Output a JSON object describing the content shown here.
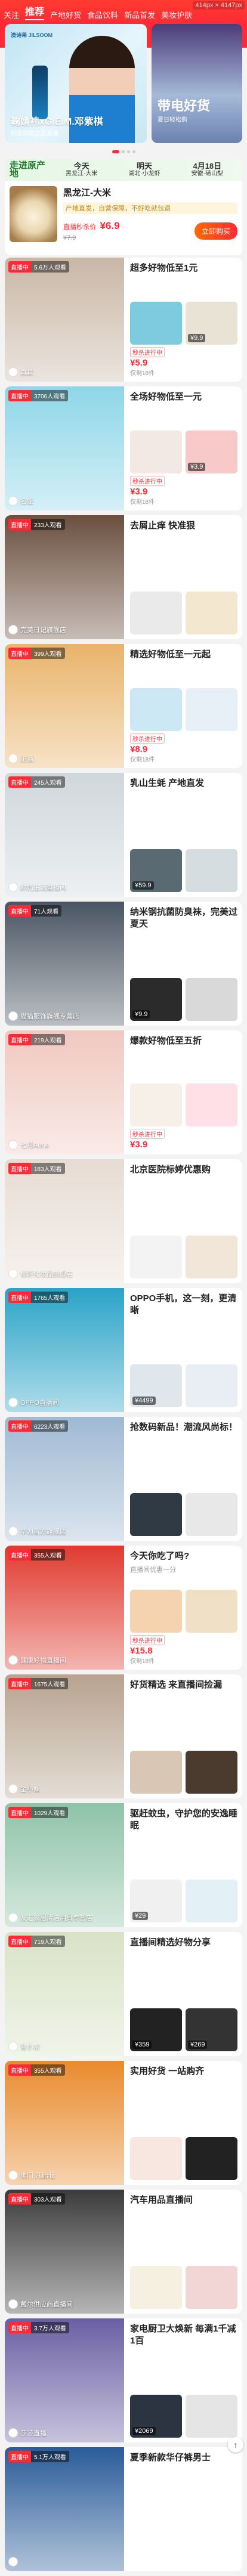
{
  "nav": {
    "tabs": [
      "关注",
      "推荐",
      "产地好货",
      "食品饮料",
      "新品首发",
      "美妆护肤"
    ],
    "active_index": 1,
    "dimension_label": "414px × 4147px"
  },
  "banner_main": {
    "brand": "澳诗茉 JILSOOM",
    "title": "鞠婧祎xG.E.M.邓紫棋",
    "subtitle": "明星同款正品直播"
  },
  "banner_side": {
    "word": "带电好货",
    "subtitle": "夏日轻松购"
  },
  "origin": {
    "logo": "走进原产地",
    "days": [
      {
        "label": "今天",
        "place": "黑龙江·大米"
      },
      {
        "label": "明天",
        "place": "湖北·小龙虾"
      },
      {
        "label": "4月18日",
        "place": "安徽·砀山梨"
      }
    ],
    "product_name": "黑龙江-大米",
    "tag": "产地直发，自营保障，不好吃就包退",
    "sale_label": "直播秒杀价",
    "price": "¥6.9",
    "orig_price": "¥7.9",
    "buy_label": "立即购买"
  },
  "cards": [
    {
      "views": "5.6万人观看",
      "host": "真真",
      "title": "超多好物低至1元",
      "tagline": "",
      "cover_color": "#c9b7a6",
      "products": [
        {
          "price": "¥5.9",
          "remain": "仅剩18件",
          "color": "#7ecbe0",
          "seckill": "秒杀进行中"
        },
        {
          "price": "¥9.9",
          "remain": "仅剩",
          "color": "#e9e3d6",
          "seckill": ""
        }
      ]
    },
    {
      "views": "3706人观看",
      "host": "名媛",
      "title": "全场好物低至一元",
      "tagline": "",
      "cover_color": "#8dd6e8",
      "products": [
        {
          "price": "¥3.9",
          "remain": "仅剩18件",
          "color": "#f3e9e4",
          "seckill": "秒杀进行中"
        },
        {
          "price": "¥3.9",
          "remain": "仅剩",
          "color": "#f7c9c9",
          "seckill": ""
        }
      ]
    },
    {
      "views": "233人观看",
      "host": "完美日记旗舰店",
      "title": "去屑止痒 快准狠",
      "tagline": "",
      "cover_color": "#6b4f3f",
      "products": [
        {
          "price": "",
          "remain": "",
          "color": "#eaeaea",
          "seckill": ""
        },
        {
          "price": "",
          "remain": "",
          "color": "#f4e7d0",
          "seckill": ""
        }
      ]
    },
    {
      "views": "399人观看",
      "host": "主播",
      "title": "精选好物低至一元起",
      "tagline": "",
      "cover_color": "#e9b36a",
      "products": [
        {
          "price": "¥8.9",
          "remain": "仅剩18件",
          "color": "#cde8f5",
          "seckill": "秒杀进行中"
        },
        {
          "price": "",
          "remain": "",
          "color": "#e8f0f7",
          "seckill": ""
        }
      ]
    },
    {
      "views": "245人观看",
      "host": "鲜奶生活直播间",
      "title": "乳山生蚝 产地直发",
      "tagline": "",
      "cover_color": "#cfd7db",
      "products": [
        {
          "price": "¥59.9",
          "remain": "",
          "color": "#5a6a72",
          "seckill": ""
        },
        {
          "price": "",
          "remain": "",
          "color": "#d5dde0",
          "seckill": ""
        }
      ]
    },
    {
      "views": "71人观看",
      "host": "猫猫服饰旗舰专营店",
      "title": "纳米钢抗菌防臭袜，完美过夏天",
      "tagline": "",
      "cover_color": "#4a5563",
      "products": [
        {
          "price": "¥9.9",
          "remain": "",
          "color": "#2b2b2b",
          "seckill": ""
        },
        {
          "price": "",
          "remain": "",
          "color": "#d9d9d9",
          "seckill": ""
        }
      ]
    },
    {
      "views": "219人观看",
      "host": "七月Anne",
      "title": "爆款好物低至五折",
      "tagline": "",
      "cover_color": "#f0c8c0",
      "products": [
        {
          "price": "¥3.9",
          "remain": "",
          "color": "#f7f0e8",
          "seckill": "秒杀进行中"
        },
        {
          "price": "",
          "remain": "",
          "color": "#ffe0e6",
          "seckill": ""
        }
      ]
    },
    {
      "views": "183人观看",
      "host": "标婷化妆品旗舰店",
      "title": "北京医院标婷优惠购",
      "tagline": "",
      "cover_color": "#e7dcd3",
      "products": [
        {
          "price": "",
          "remain": "",
          "color": "#f3f3f3",
          "seckill": ""
        },
        {
          "price": "",
          "remain": "",
          "color": "#f2e6d9",
          "seckill": ""
        }
      ]
    },
    {
      "views": "1765人观看",
      "host": "OPPO直播间",
      "title": "OPPO手机，这一刻，更清晰",
      "tagline": "",
      "cover_color": "#2aa3c7",
      "products": [
        {
          "price": "¥4499",
          "remain": "",
          "color": "#dfe6ec",
          "seckill": ""
        },
        {
          "price": "",
          "remain": "",
          "color": "#e8eef3",
          "seckill": ""
        }
      ]
    },
    {
      "views": "6223人观看",
      "host": "华为官方旗舰店",
      "title": "抢数码新品！潮流风尚标！",
      "tagline": "",
      "cover_color": "#9fb9d3",
      "products": [
        {
          "price": "",
          "remain": "",
          "color": "#2f3a45",
          "seckill": ""
        },
        {
          "price": "",
          "remain": "",
          "color": "#e8e8e8",
          "seckill": ""
        }
      ]
    },
    {
      "views": "355人观看",
      "host": "健康好物直播间",
      "title": "今天你吃了吗?",
      "tagline": "直播间优惠一分",
      "cover_color": "#e03a2e",
      "products": [
        {
          "price": "¥15.8",
          "remain": "仅剩18件",
          "color": "#f5d2b0",
          "seckill": "秒杀进行中"
        },
        {
          "price": "",
          "remain": "",
          "color": "#f0e0c5",
          "seckill": ""
        }
      ]
    },
    {
      "views": "1675人观看",
      "host": "金小妹",
      "title": "好货精选 来直播间捡漏",
      "tagline": "",
      "cover_color": "#b7a38f",
      "products": [
        {
          "price": "",
          "remain": "",
          "color": "#d8c7b5",
          "seckill": ""
        },
        {
          "price": "",
          "remain": "",
          "color": "#4a3b2e",
          "seckill": ""
        }
      ]
    },
    {
      "views": "1029人观看",
      "host": "友汇家居清洁用具专营店",
      "title": "驱赶蚊虫，守护您的安逸睡眠",
      "tagline": "",
      "cover_color": "#8fc3a8",
      "products": [
        {
          "price": "¥29",
          "remain": "",
          "color": "#f0f0f0",
          "seckill": ""
        },
        {
          "price": "",
          "remain": "",
          "color": "#e3f1f7",
          "seckill": ""
        }
      ]
    },
    {
      "views": "719人观看",
      "host": "曹小亲",
      "title": "直播间精选好物分享",
      "tagline": "",
      "cover_color": "#d9e2c6",
      "products": [
        {
          "price": "¥359",
          "remain": "",
          "color": "#222222",
          "seckill": ""
        },
        {
          "price": "¥269",
          "remain": "",
          "color": "#333333",
          "seckill": ""
        }
      ]
    },
    {
      "views": "355人观看",
      "host": "佛门 凡胎我",
      "title": "实用好货 一站购齐",
      "tagline": "",
      "cover_color": "#e98a2c",
      "products": [
        {
          "price": "",
          "remain": "",
          "color": "#f7e7e0",
          "seckill": ""
        },
        {
          "price": "",
          "remain": "",
          "color": "#222222",
          "seckill": ""
        }
      ]
    },
    {
      "views": "303人观看",
      "host": "戴尔供应商直播间",
      "title": "汽车用品直播间",
      "tagline": "",
      "cover_color": "#3b3b3b",
      "products": [
        {
          "price": "",
          "remain": "",
          "color": "#f5f0e0",
          "seckill": ""
        },
        {
          "price": "",
          "remain": "",
          "color": "#f2d6d6",
          "seckill": ""
        }
      ]
    },
    {
      "views": "3.7万人观看",
      "host": "莎莎直播",
      "title": "家电厨卫大焕新 每满1千减1百",
      "tagline": "",
      "cover_color": "#6a5fa3",
      "products": [
        {
          "price": "¥2069",
          "remain": "",
          "color": "#2b3440",
          "seckill": ""
        },
        {
          "price": "",
          "remain": "",
          "color": "#e5e5e5",
          "seckill": ""
        }
      ]
    },
    {
      "views": "5.1万人观看",
      "host": "",
      "title": "夏季新款华仔裤男士",
      "tagline": "",
      "cover_color": "#2a5c99",
      "products": []
    }
  ]
}
